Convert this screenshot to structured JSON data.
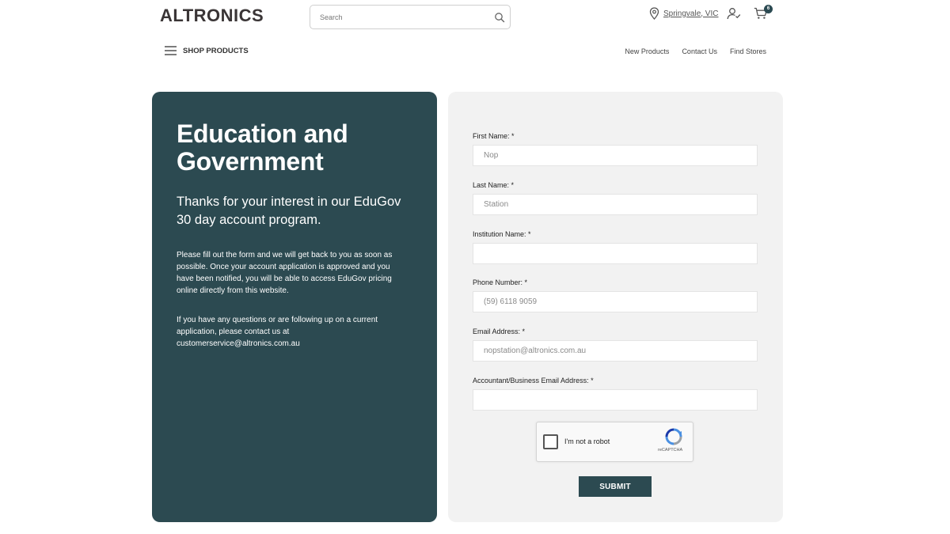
{
  "header": {
    "logo": "ALTRONICS",
    "search_placeholder": "Search",
    "location": "Springvale, VIC",
    "cart_count": "6"
  },
  "nav": {
    "shop_label": "SHOP PRODUCTS",
    "links": [
      "New Products",
      "Contact Us",
      "Find Stores"
    ]
  },
  "left": {
    "heading": "Education and Government",
    "subheading": "Thanks for your interest in our EduGov 30 day account program.",
    "paragraph1": "Please fill out the form and we will get back to you as soon as possible. Once your account application is approved and you have been notified, you will be able to access EduGov pricing online directly from this website.",
    "paragraph2": "If you have any questions or are following up on a current application, please contact us at customerservice@altronics.com.au"
  },
  "form": {
    "first_name": {
      "label": "First Name: *",
      "placeholder": "Nop"
    },
    "last_name": {
      "label": "Last Name: *",
      "placeholder": "Station"
    },
    "institution": {
      "label": "Institution Name: *",
      "placeholder": ""
    },
    "phone": {
      "label": "Phone Number: *",
      "placeholder": "(59) 6118 9059"
    },
    "email": {
      "label": "Email Address: *",
      "placeholder": "nopstation@altronics.com.au"
    },
    "accountant_email": {
      "label": "Accountant/Business Email Address: *",
      "placeholder": ""
    },
    "captcha_text": "I'm not a robot",
    "captcha_brand": "reCAPTCHA",
    "submit_label": "SUBMIT"
  },
  "colors": {
    "panel": "#2c4a51",
    "form_bg": "#f2f2f2"
  }
}
